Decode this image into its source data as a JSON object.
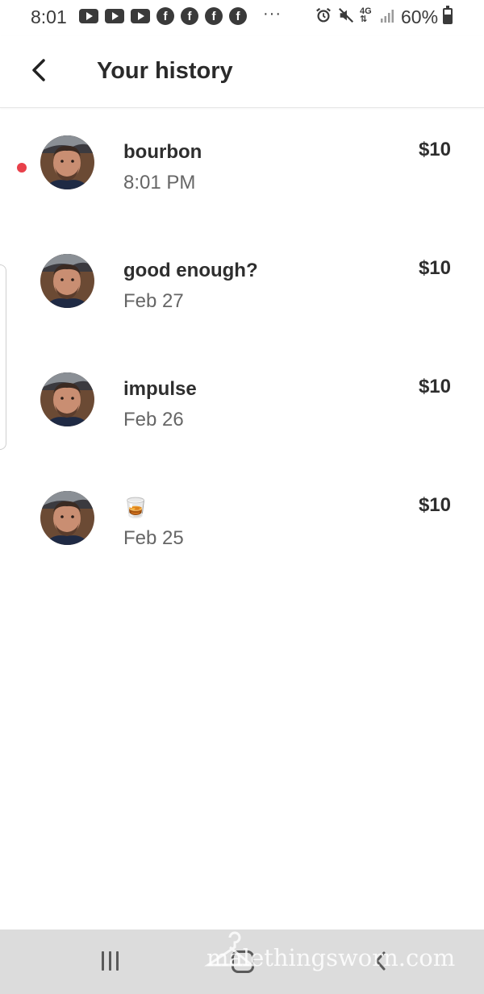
{
  "status_bar": {
    "time": "8:01",
    "notification_icons": [
      "youtube-icon",
      "youtube-icon",
      "youtube-icon",
      "facebook-icon",
      "facebook-icon",
      "facebook-icon",
      "facebook-icon"
    ],
    "overflow": "···",
    "system_icons": [
      "alarm-icon",
      "mute-icon",
      "data-transfer-icon",
      "signal-icon"
    ],
    "battery_percent": "60%",
    "battery_level": 0.6
  },
  "header": {
    "back_icon": "chevron-left-icon",
    "title": "Your history"
  },
  "history": [
    {
      "title": "bourbon",
      "date": "8:01 PM",
      "amount": "$10",
      "unread": true
    },
    {
      "title": "good enough?",
      "date": "Feb 27",
      "amount": "$10",
      "unread": false
    },
    {
      "title": "impulse",
      "date": "Feb 26",
      "amount": "$10",
      "unread": false
    },
    {
      "title": "🥃",
      "date": "Feb 25",
      "amount": "$10",
      "unread": false
    }
  ],
  "colors": {
    "unread_dot": "#e8404a",
    "text_primary": "#2e2e2e",
    "text_secondary": "#666666",
    "nav_bar": "#dcdcdc"
  },
  "nav_bar": {
    "recents_icon": "recents-icon",
    "home_icon": "home-icon",
    "back_icon": "back-icon"
  },
  "watermark": {
    "text": "malethingsworn.com"
  }
}
